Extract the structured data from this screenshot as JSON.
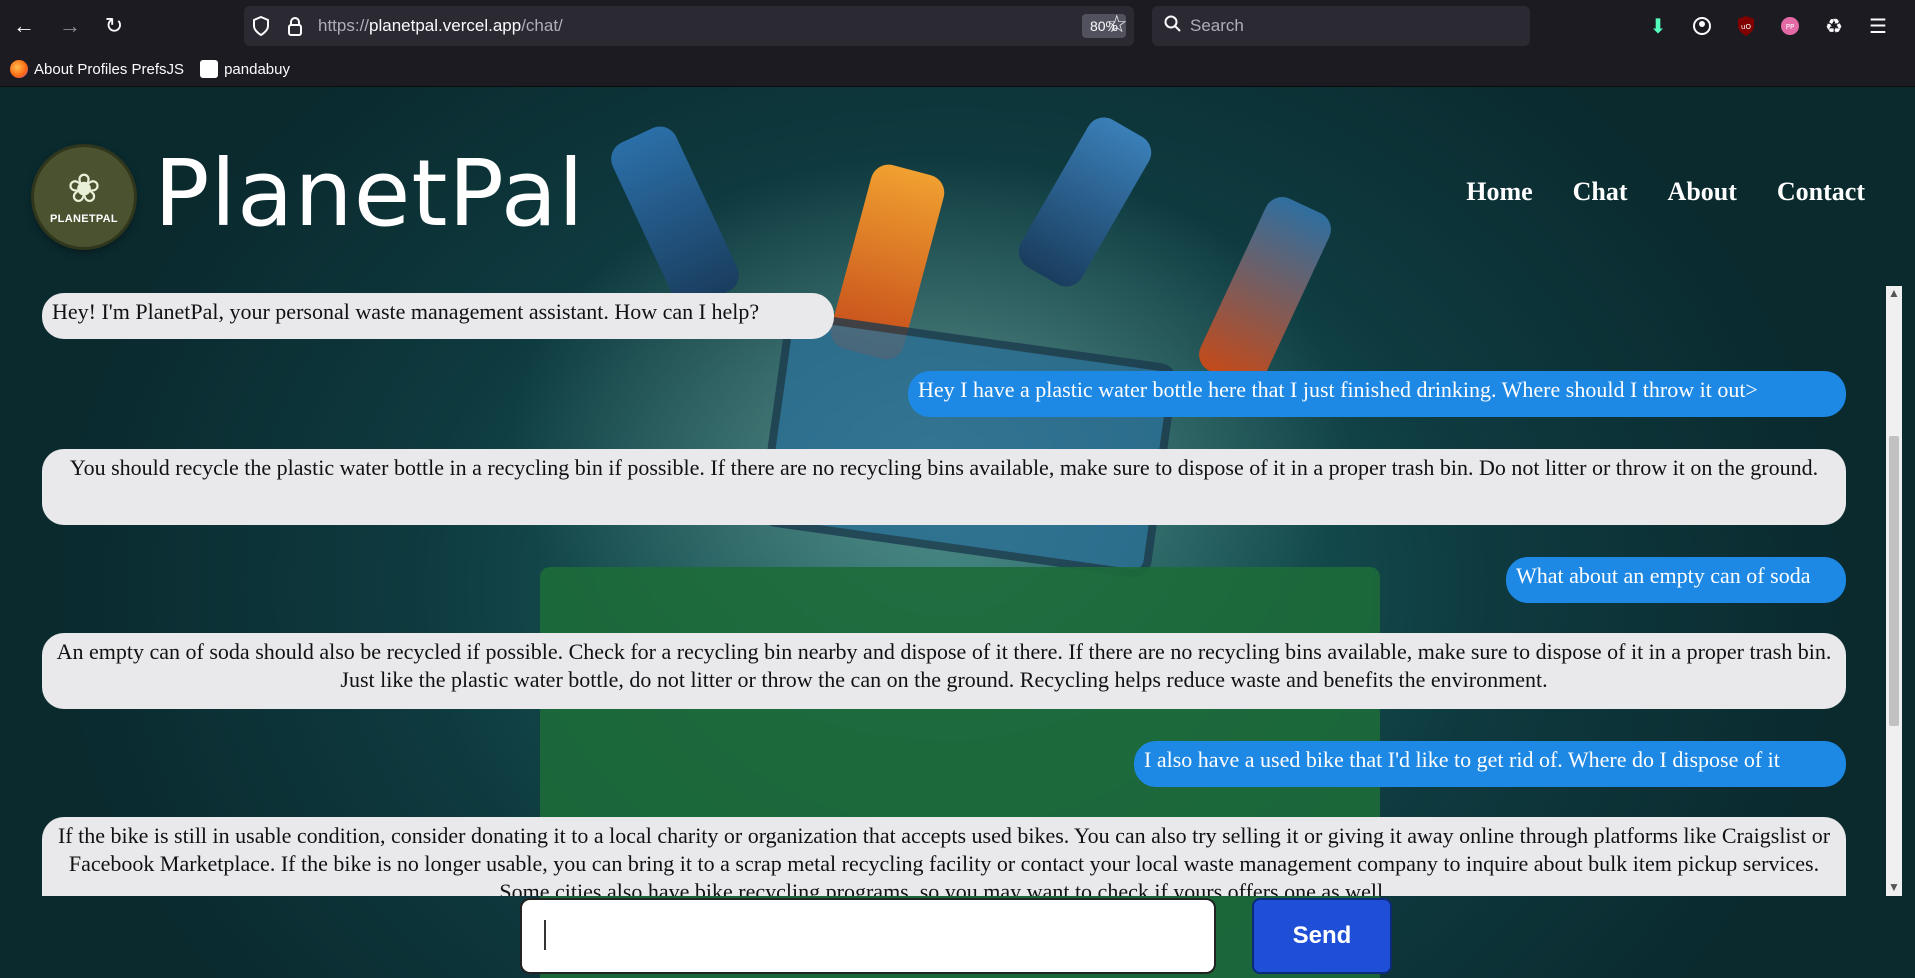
{
  "browser": {
    "url_prefix": "https://",
    "url_host": "planetpal.vercel.app",
    "url_path": "/chat/",
    "zoom": "80%",
    "search_placeholder": "Search",
    "bookmarks": [
      {
        "label": "About Profiles PrefsJS",
        "icon": "firefox-icon"
      },
      {
        "label": "pandabuy",
        "icon": "panda-icon"
      }
    ]
  },
  "header": {
    "logo_text": "PLANETPAL",
    "brand": "PlanetPal",
    "nav": [
      "Home",
      "Chat",
      "About",
      "Contact"
    ]
  },
  "chat": {
    "messages": [
      {
        "role": "bot",
        "text": "Hey! I'm PlanetPal, your personal waste management assistant. How can I help?"
      },
      {
        "role": "user",
        "text": "Hey I have a plastic water bottle here that I just finished drinking. Where should I throw it out>"
      },
      {
        "role": "bot",
        "text": "You should recycle the plastic water bottle in a recycling bin if possible. If there are no recycling bins available, make sure to dispose of it in a proper trash bin. Do not litter or throw it on the ground."
      },
      {
        "role": "user",
        "text": "What about an empty can of soda"
      },
      {
        "role": "bot",
        "text": "An empty can of soda should also be recycled if possible. Check for a recycling bin nearby and dispose of it there. If there are no recycling bins available, make sure to dispose of it in a proper trash bin. Just like the plastic water bottle, do not litter or throw the can on the ground. Recycling helps reduce waste and benefits the environment."
      },
      {
        "role": "user",
        "text": "I also have a used bike that I'd like to get rid of. Where do I dispose of it"
      },
      {
        "role": "bot",
        "text": "If the bike is still in usable condition, consider donating it to a local charity or organization that accepts used bikes. You can also try selling it or giving it away online through platforms like Craigslist or Facebook Marketplace. If the bike is no longer usable, you can bring it to a scrap metal recycling facility or contact your local waste management company to inquire about bulk item pickup services. Some cities also have bike recycling programs, so you may want to check if yours offers one as well."
      }
    ]
  },
  "composer": {
    "input_value": "",
    "send_label": "Send"
  }
}
